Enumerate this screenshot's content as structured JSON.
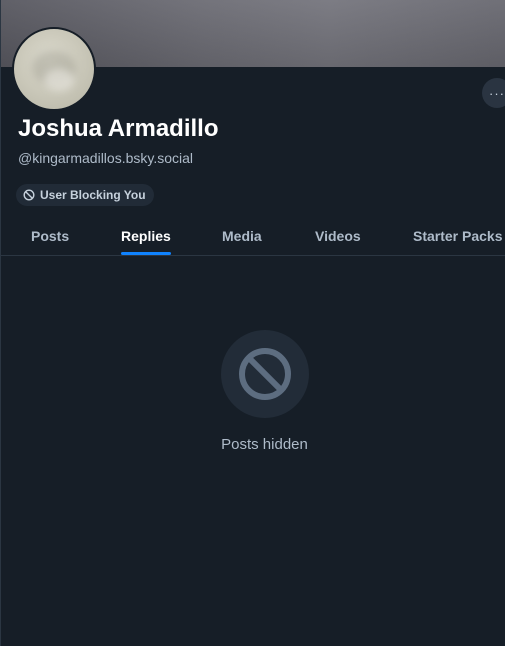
{
  "profile": {
    "display_name": "Joshua Armadillo",
    "handle": "@kingarmadillos.bsky.social",
    "more_button_label": "···",
    "badge": {
      "icon": "block-icon",
      "label": "User Blocking You"
    }
  },
  "tabs": [
    {
      "label": "Posts",
      "active": false
    },
    {
      "label": "Replies",
      "active": true
    },
    {
      "label": "Media",
      "active": false
    },
    {
      "label": "Videos",
      "active": false
    },
    {
      "label": "Starter Packs",
      "active": false
    }
  ],
  "empty_state": {
    "icon": "block-icon",
    "message": "Posts hidden"
  },
  "colors": {
    "background": "#161e27",
    "accent": "#1083fe",
    "text_primary": "#ffffff",
    "text_secondary": "#aebbc9"
  }
}
